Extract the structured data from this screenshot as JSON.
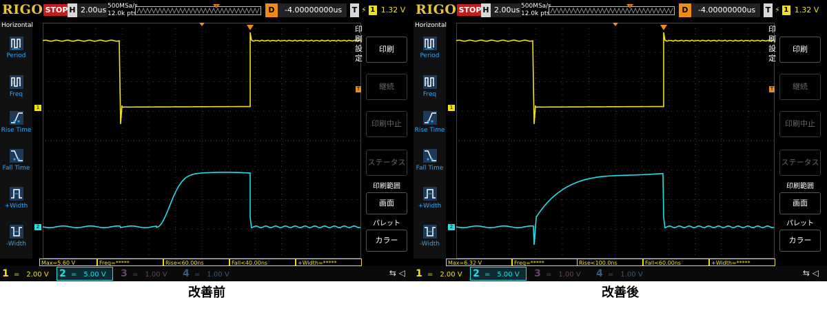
{
  "scopes": [
    {
      "logo": "RIGOL",
      "status": "STOP",
      "timebase": {
        "tag": "H",
        "value": "2.00us"
      },
      "sample_rate": "500MSa/s",
      "points": "12.0k pts",
      "delay": {
        "tag": "D",
        "value": "-4.00000000us"
      },
      "trigger": {
        "tag": "T",
        "channel": "1",
        "level": "1.32 V"
      },
      "left_menu": {
        "title": "Horizontal",
        "items": [
          "Period",
          "Freq",
          "Rise Time",
          "Fall Time",
          "+Width",
          "-Width"
        ]
      },
      "right_menu": {
        "vertical_label": [
          "印",
          "刷",
          "設",
          "定"
        ],
        "buttons": [
          {
            "caption": "",
            "label": "印刷",
            "enabled": true
          },
          {
            "caption": "",
            "label": "継続",
            "enabled": false
          },
          {
            "caption": "",
            "label": "印刷中止",
            "enabled": false
          },
          {
            "caption": "",
            "label": "ステータス",
            "enabled": false
          },
          {
            "caption": "印刷範囲",
            "label": "画面",
            "enabled": true
          },
          {
            "caption": "パレット",
            "label": "カラー",
            "enabled": true
          }
        ]
      },
      "measurements": [
        {
          "label": "Max=5.60 V"
        },
        {
          "label": "Freq=*****"
        },
        {
          "label": "Rise<60.00ns"
        },
        {
          "label": "Fall<40.00ns"
        },
        {
          "label": "+Width=*****"
        }
      ],
      "channels": [
        {
          "num": "1",
          "value": "2.00 V",
          "color": "#f0e020",
          "active": true
        },
        {
          "num": "2",
          "value": "5.00 V",
          "color": "#22e0e8",
          "active": true
        },
        {
          "num": "3",
          "value": "1.00 V",
          "color": "#c050c0",
          "active": false
        },
        {
          "num": "4",
          "value": "1.00 V",
          "color": "#3d7fd0",
          "active": false
        }
      ],
      "waveform": {
        "ch2_overshoot": 0.0,
        "ch2_rise_sharp": 0.08
      },
      "caption": "改善前"
    },
    {
      "logo": "RIGOL",
      "status": "STOP",
      "timebase": {
        "tag": "H",
        "value": "2.00us"
      },
      "sample_rate": "500MSa/s",
      "points": "12.0k pts",
      "delay": {
        "tag": "D",
        "value": "-4.00000000us"
      },
      "trigger": {
        "tag": "T",
        "channel": "1",
        "level": "1.32 V"
      },
      "left_menu": {
        "title": "Horizontal",
        "items": [
          "Period",
          "Freq",
          "Rise Time",
          "Fall Time",
          "+Width",
          "-Width"
        ]
      },
      "right_menu": {
        "vertical_label": [
          "印",
          "刷",
          "設",
          "定"
        ],
        "buttons": [
          {
            "caption": "",
            "label": "印刷",
            "enabled": true
          },
          {
            "caption": "",
            "label": "継続",
            "enabled": false
          },
          {
            "caption": "",
            "label": "印刷中止",
            "enabled": false
          },
          {
            "caption": "",
            "label": "ステータス",
            "enabled": false
          },
          {
            "caption": "印刷範囲",
            "label": "画面",
            "enabled": true
          },
          {
            "caption": "パレット",
            "label": "カラー",
            "enabled": true
          }
        ]
      },
      "measurements": [
        {
          "label": "Max=6.32 V"
        },
        {
          "label": "Freq=*****"
        },
        {
          "label": "Rise<100.0ns"
        },
        {
          "label": "Fall<60.00ns"
        },
        {
          "label": "+Width=*****"
        }
      ],
      "channels": [
        {
          "num": "1",
          "value": "2.00 V",
          "color": "#f0e020",
          "active": true
        },
        {
          "num": "2",
          "value": "5.00 V",
          "color": "#22e0e8",
          "active": true
        },
        {
          "num": "3",
          "value": "1.00 V",
          "color": "#c050c0",
          "active": false
        },
        {
          "num": "4",
          "value": "1.00 V",
          "color": "#3d7fd0",
          "active": false
        }
      ],
      "waveform": {
        "ch2_overshoot": 1.0,
        "ch2_rise_sharp": 0.03
      },
      "caption": "改善後"
    }
  ],
  "colors": {
    "ch1": "#f0e020",
    "ch2": "#22e0e8",
    "menu_text": "#2fa8ff",
    "stop_bg": "#c71c1c",
    "delay_tag": "#f08a1a"
  }
}
